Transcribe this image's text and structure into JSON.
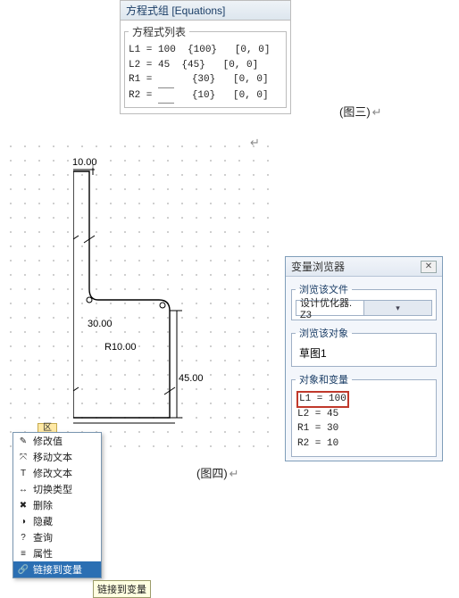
{
  "equations_panel": {
    "title": "方程式组 [Equations]",
    "legend": "方程式列表",
    "rows": [
      {
        "name": "L1",
        "value": "100",
        "input": false,
        "brace": "{100}",
        "range": "[0, 0]"
      },
      {
        "name": "L2",
        "value": "45",
        "input": false,
        "brace": "{45}",
        "range": "[0, 0]"
      },
      {
        "name": "R1",
        "value": "",
        "input": true,
        "brace": "{30}",
        "range": "[0, 0]"
      },
      {
        "name": "R2",
        "value": "",
        "input": true,
        "brace": "{10}",
        "range": "[0, 0]"
      }
    ]
  },
  "captions": {
    "fig3": "(图三)",
    "fig4": "(图四)",
    "ret": "↵"
  },
  "drawing": {
    "dims": {
      "top": "10.00",
      "mid": "30.00",
      "r10": "R10.00",
      "h45": "45.00"
    },
    "marker": "区",
    "context_menu": [
      {
        "label": "修改值",
        "icon": "✎"
      },
      {
        "label": "移动文本",
        "icon": "⤧"
      },
      {
        "label": "修改文本",
        "icon": "T"
      },
      {
        "label": "切换类型",
        "icon": "↔"
      },
      {
        "label": "删除",
        "icon": "✖"
      },
      {
        "label": "隐藏",
        "icon": "◑"
      },
      {
        "label": "查询",
        "icon": "?"
      },
      {
        "label": "属性",
        "icon": "≡"
      },
      {
        "label": "链接到变量",
        "icon": "🔗",
        "selected": true
      }
    ],
    "tooltip": "链接到变量"
  },
  "variable_browser": {
    "title": "变量浏览器",
    "close": "✕",
    "sections": {
      "file": {
        "legend": "浏览该文件",
        "value": "设计优化器. Z3"
      },
      "object": {
        "legend": "浏览该对象",
        "value": "草图1"
      },
      "vars": {
        "legend": "对象和变量",
        "rows": [
          {
            "text": "L1 = 100",
            "highlight": true
          },
          {
            "text": "L2 = 45",
            "highlight": false
          },
          {
            "text": "R1 = 30",
            "highlight": false
          },
          {
            "text": "R2 = 10",
            "highlight": false
          }
        ]
      }
    }
  }
}
